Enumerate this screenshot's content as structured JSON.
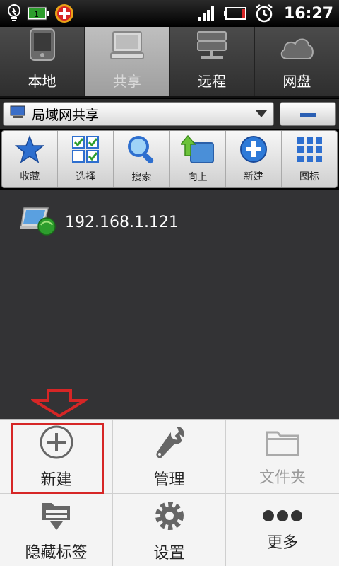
{
  "status_bar": {
    "time": "16:27",
    "icons": [
      "bulb-icon",
      "battery-charge-icon",
      "app-badge-icon",
      "signal-icon",
      "battery-low-icon",
      "alarm-icon"
    ]
  },
  "tabs": [
    {
      "label": "本地",
      "icon": "tablet-icon",
      "active": false
    },
    {
      "label": "共享",
      "icon": "monitor-icon",
      "active": true
    },
    {
      "label": "远程",
      "icon": "server-icon",
      "active": false
    },
    {
      "label": "网盘",
      "icon": "cloud-icon",
      "active": false
    }
  ],
  "address": {
    "path": "局域网共享"
  },
  "toolbar": [
    {
      "label": "收藏",
      "icon": "star-icon"
    },
    {
      "label": "选择",
      "icon": "checkbox-grid-icon"
    },
    {
      "label": "搜索",
      "icon": "magnifier-icon"
    },
    {
      "label": "向上",
      "icon": "up-folder-icon"
    },
    {
      "label": "新建",
      "icon": "plus-circle-icon"
    },
    {
      "label": "图标",
      "icon": "grid-icon"
    }
  ],
  "files": [
    {
      "name": "192.168.1.121",
      "icon": "network-computer-icon"
    }
  ],
  "menu": [
    {
      "label": "新建",
      "icon": "plus-circle-icon",
      "disabled": false
    },
    {
      "label": "管理",
      "icon": "wrench-icon",
      "disabled": false
    },
    {
      "label": "文件夹",
      "icon": "folder-icon",
      "disabled": true
    },
    {
      "label": "隐藏标签",
      "icon": "hide-tabs-icon",
      "disabled": false
    },
    {
      "label": "设置",
      "icon": "gear-icon",
      "disabled": false
    },
    {
      "label": "更多",
      "icon": "more-dots-icon",
      "disabled": false
    }
  ],
  "colors": {
    "highlight": "#d62626",
    "content_bg": "#333335",
    "menu_bg": "#f4f4f4"
  }
}
